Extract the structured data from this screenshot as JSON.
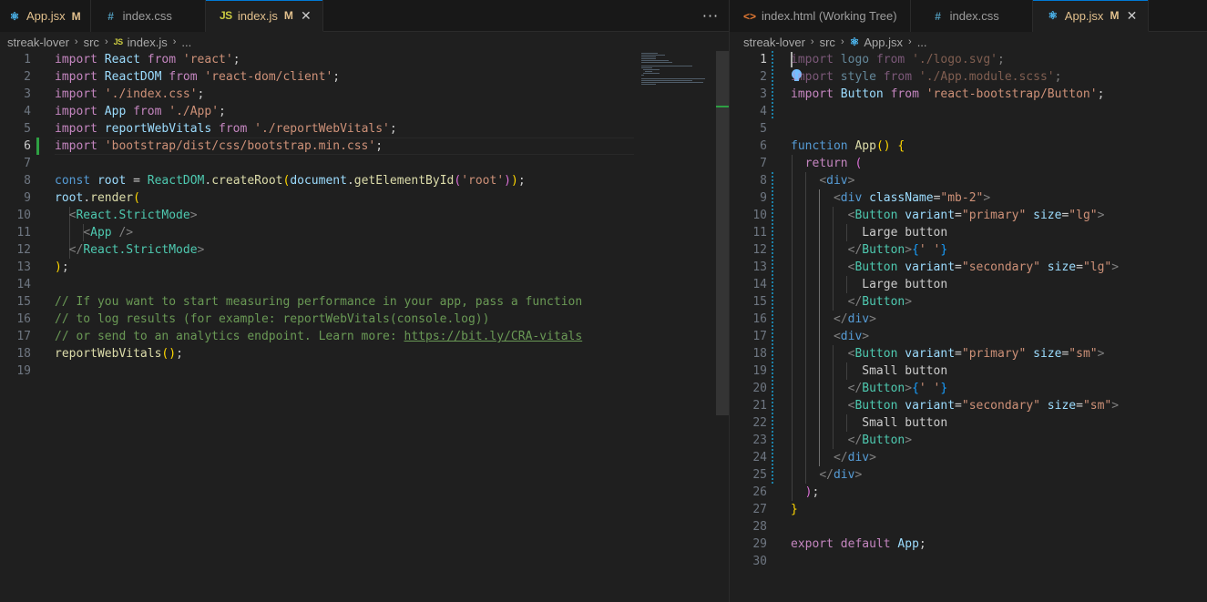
{
  "left_editor": {
    "tabs": [
      {
        "icon": "react-icon",
        "label": "App.jsx",
        "status": "M",
        "active": false,
        "modified": true
      },
      {
        "icon": "css-icon",
        "label": "index.css",
        "status": "",
        "active": false,
        "modified": false
      },
      {
        "icon": "js-icon",
        "label": "index.js",
        "status": "M",
        "active": true,
        "modified": true
      }
    ],
    "icon_glyphs": {
      "react": "⚛",
      "css": "#",
      "js": "JS",
      "html": "<>"
    },
    "more_label": "···",
    "close_label": "✕",
    "breadcrumb": {
      "folder1": "streak-lover",
      "folder2": "src",
      "file": "index.js",
      "ellipsis": "...",
      "sep": "›"
    },
    "lines": [
      "1",
      "2",
      "3",
      "4",
      "5",
      "6",
      "7",
      "8",
      "9",
      "10",
      "11",
      "12",
      "13",
      "14",
      "15",
      "16",
      "17",
      "18",
      "19"
    ],
    "code": {
      "import": "import",
      "from": "from",
      "const": "const",
      "react_id": "React",
      "react_str": "'react'",
      "reactdom_id": "ReactDOM",
      "reactdom_str": "'react-dom/client'",
      "indexcss_str": "'./index.css'",
      "app_id": "App",
      "app_str": "'./App'",
      "rwv_id": "reportWebVitals",
      "rwv_str": "'./reportWebVitals'",
      "bootstrap_str": "'bootstrap/dist/css/bootstrap.min.css'",
      "root": "root",
      "eq": "=",
      "createRoot": "createRoot",
      "document": "document",
      "getElementById": "getElementById",
      "root_str": "'root'",
      "render": "render",
      "strictmode": "React.StrictMode",
      "app_tag": "App",
      "comment15": "// If you want to start measuring performance in your app, pass a function",
      "comment16": "// to log results (for example: reportWebVitals(console.log))",
      "comment17": "// or send to an analytics endpoint. Learn more: ",
      "comment17_link": "https://bit.ly/CRA-vitals",
      "rwv_call": "reportWebVitals"
    }
  },
  "right_editor": {
    "tabs": [
      {
        "icon": "html-icon",
        "label": "index.html (Working Tree)",
        "status": "",
        "active": false,
        "modified": false
      },
      {
        "icon": "css-icon",
        "label": "index.css",
        "status": "",
        "active": false,
        "modified": false
      },
      {
        "icon": "react-icon",
        "label": "App.jsx",
        "status": "M",
        "active": true,
        "modified": true
      }
    ],
    "close_label": "✕",
    "breadcrumb": {
      "folder1": "streak-lover",
      "folder2": "src",
      "file": "App.jsx",
      "ellipsis": "...",
      "sep": "›"
    },
    "lines": [
      "1",
      "2",
      "3",
      "4",
      "5",
      "6",
      "7",
      "8",
      "9",
      "10",
      "11",
      "12",
      "13",
      "14",
      "15",
      "16",
      "17",
      "18",
      "19",
      "20",
      "21",
      "22",
      "23",
      "24",
      "25",
      "26",
      "27",
      "28",
      "29",
      "30"
    ],
    "code": {
      "import": "import",
      "from": "from",
      "logo_id": "logo",
      "logo_str": "'./logo.svg'",
      "style_id": "style",
      "style_str": "'./App.module.scss'",
      "button_id": "Button",
      "button_str": "'react-bootstrap/Button'",
      "function": "function",
      "app_name": "App",
      "return": "return",
      "div": "div",
      "className": "className",
      "mb2": "\"mb-2\"",
      "Button": "Button",
      "variant": "variant",
      "size": "size",
      "primary": "\"primary\"",
      "secondary": "\"secondary\"",
      "lg": "\"lg\"",
      "sm": "\"sm\"",
      "large_button": "Large button",
      "small_button": "Small button",
      "space_str": "' '",
      "export": "export",
      "default": "default"
    }
  }
}
